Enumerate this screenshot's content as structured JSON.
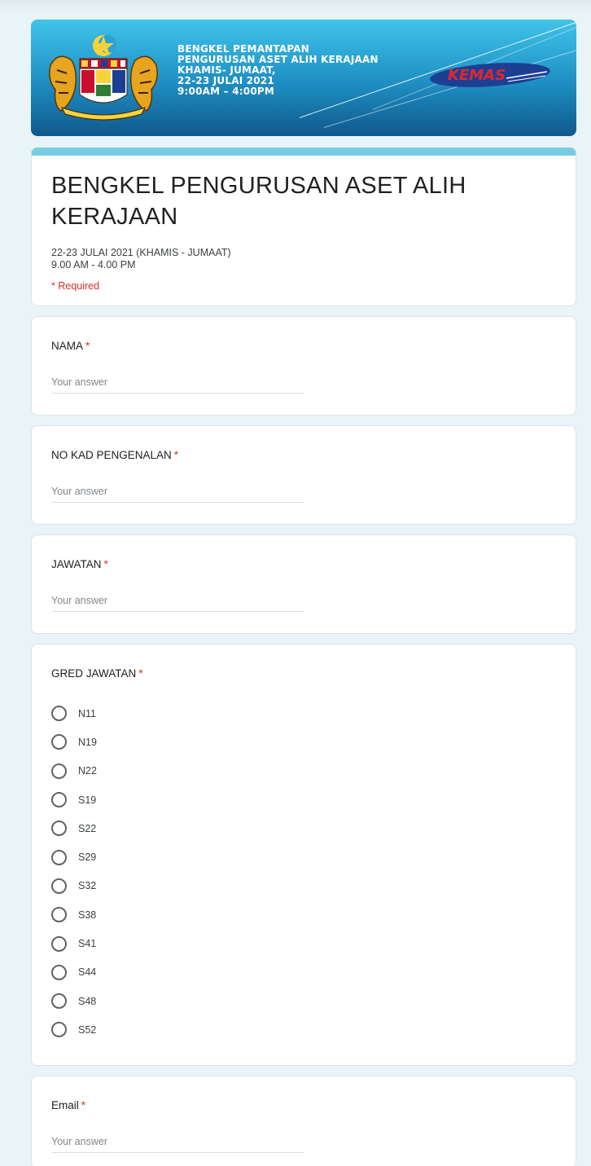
{
  "banner": {
    "lines": [
      "BENGKEL PEMANTAPAN",
      "PENGURUSAN ASET ALIH KERAJAAN",
      "KHAMIS- JUMAAT,",
      "22-23 JULAI 2021",
      "9:00AM – 4:00PM"
    ],
    "logo_text": "KEMAS",
    "crest_icon": "malaysia-coat-of-arms",
    "colors": {
      "top": "#3fc4ea",
      "bottom": "#10598c",
      "logo_red": "#e3262c",
      "logo_blue": "#1c3f94"
    }
  },
  "form": {
    "title": "BENGKEL PENGURUSAN ASET ALIH KERAJAAN",
    "description_lines": [
      "22-23 JULAI 2021 (KHAMIS - JUMAAT)",
      "9.00 AM - 4.00 PM"
    ],
    "required_note": "* Required",
    "accent_color": "#79cde3"
  },
  "questions": {
    "nama": {
      "label": "NAMA",
      "required_mark": "*",
      "placeholder": "Your answer"
    },
    "ic": {
      "label": "NO KAD PENGENALAN",
      "required_mark": "*",
      "placeholder": "Your answer"
    },
    "jawatan": {
      "label": "JAWATAN",
      "required_mark": "*",
      "placeholder": "Your answer"
    },
    "gred": {
      "label": "GRED JAWATAN",
      "required_mark": "*",
      "options": [
        "N11",
        "N19",
        "N22",
        "S19",
        "S22",
        "S29",
        "S32",
        "S38",
        "S41",
        "S44",
        "S48",
        "S52"
      ]
    },
    "email": {
      "label": "Email",
      "required_mark": "*",
      "placeholder": "Your answer"
    }
  }
}
